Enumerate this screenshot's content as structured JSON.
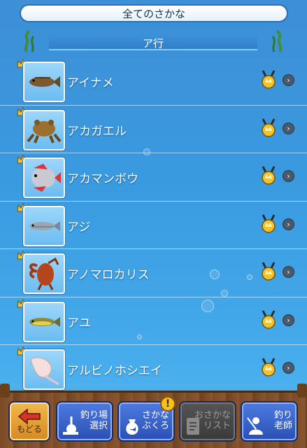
{
  "header": {
    "title": "全てのさかな"
  },
  "section": {
    "title": "ア行"
  },
  "fish": [
    {
      "name": "アイナメ",
      "icon": "ainame-fish-icon"
    },
    {
      "name": "アカガエル",
      "icon": "frog-icon"
    },
    {
      "name": "アカマンボウ",
      "icon": "opah-fish-icon"
    },
    {
      "name": "アジ",
      "icon": "horse-mackerel-icon"
    },
    {
      "name": "アノマロカリス",
      "icon": "anomalocaris-icon"
    },
    {
      "name": "アユ",
      "icon": "ayu-fish-icon"
    },
    {
      "name": "アルビノホシエイ",
      "icon": "albino-stingray-icon"
    }
  ],
  "toolbar": {
    "back_label": "もどる",
    "fishing_spot_label_1": "釣り場",
    "fishing_spot_label_2": "選択",
    "fish_bag_label_1": "さかな",
    "fish_bag_label_2": "ぶくろ",
    "fish_bag_badge": "!",
    "fish_list_label_1": "おさかな",
    "fish_list_label_2": "リスト",
    "teacher_label_1": "釣り",
    "teacher_label_2": "老師"
  },
  "colors": {
    "accent": "#2a6fb3",
    "gold": "#e8b21c",
    "wood": "#7a4b26"
  }
}
